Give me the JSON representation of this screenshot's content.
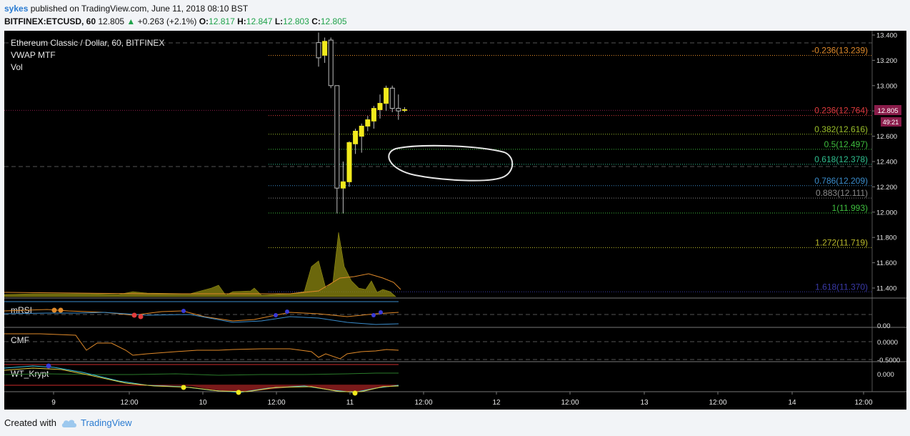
{
  "header": {
    "user": "sykes",
    "published": "published on TradingView.com, June 11, 2018 08:10 BST",
    "symbol": "BITFINEX:ETCUSD, 60",
    "last": "12.805",
    "change": "+0.263 (+2.1%)",
    "open_label": "O:",
    "open": "12.817",
    "high_label": "H:",
    "high": "12.847",
    "low_label": "L:",
    "low": "12.803",
    "close_label": "C:",
    "close": "12.805"
  },
  "legend": {
    "title": "Ethereum Classic / Dollar, 60, BITFINEX",
    "ind1": "VWAP MTF",
    "ind2": "Vol"
  },
  "price_tag": {
    "price": "12.805",
    "countdown": "49:21"
  },
  "panes": [
    {
      "name": "mRSI",
      "axis": [
        "0.00"
      ]
    },
    {
      "name": "CMF",
      "axis": [
        "0.0000",
        "-0.5000"
      ]
    },
    {
      "name": "WT_Krypt",
      "axis": [
        "0.000"
      ]
    }
  ],
  "footer": {
    "created": "Created with",
    "brand": "TradingView"
  },
  "colors": {
    "background": "#000000",
    "candle_up": "#f2ea1d",
    "candle_down": "#000000",
    "volume": "#8f8a10",
    "price_tag": "#8a1c4a"
  },
  "chart_data": {
    "type": "candlestick",
    "x_ticks": [
      "9",
      "12:00",
      "10",
      "12:00",
      "11",
      "12:00",
      "12",
      "12:00",
      "13",
      "12:00",
      "14",
      "12:00"
    ],
    "y_ticks": [
      13.4,
      13.2,
      13.0,
      12.8,
      12.6,
      12.4,
      12.2,
      12.0,
      11.8,
      11.6,
      11.4
    ],
    "ylim": [
      11.3,
      13.45
    ],
    "fib_levels": [
      {
        "label": "-0.236(13.239)",
        "ratio": -0.236,
        "price": 13.239,
        "color": "#e08a2a"
      },
      {
        "label": "0.236(12.764)",
        "ratio": 0.236,
        "price": 12.764,
        "color": "#e03c3c"
      },
      {
        "label": "0.382(12.616)",
        "ratio": 0.382,
        "price": 12.616,
        "color": "#9bbf2a"
      },
      {
        "label": "0.5(12.497)",
        "ratio": 0.5,
        "price": 12.497,
        "color": "#3fbf3f"
      },
      {
        "label": "0.618(12.378)",
        "ratio": 0.618,
        "price": 12.378,
        "color": "#2fbf8f"
      },
      {
        "label": "0.786(12.209)",
        "ratio": 0.786,
        "price": 12.209,
        "color": "#3a8ccc"
      },
      {
        "label": "0.883(12.111)",
        "ratio": 0.883,
        "price": 12.111,
        "color": "#8a8a8a"
      },
      {
        "label": "1(11.993)",
        "ratio": 1,
        "price": 11.993,
        "color": "#3fbf3f"
      },
      {
        "label": "1.272(11.719)",
        "ratio": 1.272,
        "price": 11.719,
        "color": "#b8b82a"
      },
      {
        "label": "1.618(11.370)",
        "ratio": 1.618,
        "price": 11.37,
        "color": "#3a3aa8"
      }
    ],
    "candles": [
      {
        "o": 13.34,
        "h": 13.42,
        "l": 13.15,
        "c": 13.22
      },
      {
        "o": 13.24,
        "h": 13.38,
        "l": 13.18,
        "c": 13.35
      },
      {
        "o": 13.36,
        "h": 13.38,
        "l": 12.98,
        "c": 13.0
      },
      {
        "o": 13.0,
        "h": 13.0,
        "l": 11.99,
        "c": 12.19
      },
      {
        "o": 12.19,
        "h": 12.4,
        "l": 11.99,
        "c": 12.24
      },
      {
        "o": 12.24,
        "h": 12.56,
        "l": 12.2,
        "c": 12.55
      },
      {
        "o": 12.54,
        "h": 12.66,
        "l": 12.46,
        "c": 12.64
      },
      {
        "o": 12.6,
        "h": 12.7,
        "l": 12.47,
        "c": 12.68
      },
      {
        "o": 12.68,
        "h": 12.76,
        "l": 12.64,
        "c": 12.73
      },
      {
        "o": 12.72,
        "h": 12.84,
        "l": 12.66,
        "c": 12.82
      },
      {
        "o": 12.81,
        "h": 12.93,
        "l": 12.74,
        "c": 12.86
      },
      {
        "o": 12.86,
        "h": 13.0,
        "l": 12.8,
        "c": 12.98
      },
      {
        "o": 12.98,
        "h": 13.0,
        "l": 12.79,
        "c": 12.82
      },
      {
        "o": 12.82,
        "h": 12.93,
        "l": 12.73,
        "c": 12.8
      },
      {
        "o": 12.81,
        "h": 12.83,
        "l": 12.79,
        "c": 12.81
      }
    ],
    "last_price": 12.805
  }
}
